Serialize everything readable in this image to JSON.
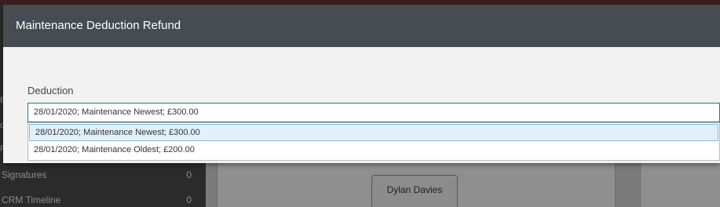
{
  "background": {
    "sidebar_rows": [
      {
        "label": "Signatures",
        "count": "0"
      },
      {
        "label": "CRM Timeline",
        "count": "0"
      }
    ],
    "card_name": "Dylan Davies",
    "partial_glyphs": [
      "E",
      "d",
      "F"
    ]
  },
  "modal": {
    "title": "Maintenance Deduction Refund",
    "field_label": "Deduction",
    "selected_value": "28/01/2020; Maintenance Newest; £300.00",
    "options": [
      "28/01/2020; Maintenance Newest; £300.00",
      "28/01/2020; Maintenance Oldest; £200.00"
    ]
  },
  "colors": {
    "header_bg": "#474b52",
    "select_border": "#1e7a87",
    "option_highlight": "#e1f0fb"
  }
}
